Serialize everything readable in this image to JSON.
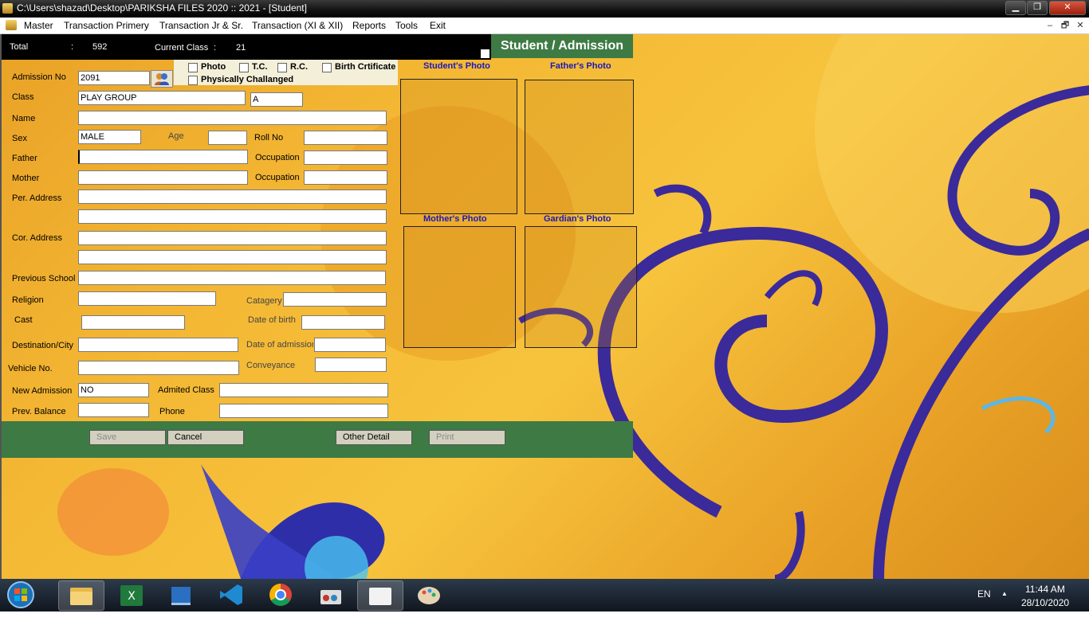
{
  "window": {
    "title": "C:\\Users\\shazad\\Desktop\\PARIKSHA FILES 2020 :: 2021 - [Student]",
    "buttons": {
      "minimize": "▁",
      "maximize": "❐",
      "close": "✕"
    }
  },
  "menubar": {
    "items": [
      "Master",
      "Transaction Primery",
      "Transaction Jr & Sr.",
      "Transaction (XI & XII)",
      "Reports",
      "Tools",
      "Exit"
    ],
    "mdi_buttons": {
      "minimize": "–",
      "restore": "🗗",
      "close": "✕"
    }
  },
  "status": {
    "total_label": "Total",
    "total_sep": ":",
    "total_value": "592",
    "class_label": "Current Class",
    "class_sep": ":",
    "class_value": "21"
  },
  "header": {
    "title": "Student / Admission"
  },
  "checkboxes": {
    "photo": "Photo",
    "tc": "T.C.",
    "rc": "R.C.",
    "birth": "Birth Crtificate",
    "physically": "Physically Challanged"
  },
  "form": {
    "admission_no": {
      "label": "Admission No",
      "value": "2091"
    },
    "class": {
      "label": "Class",
      "value": "PLAY GROUP",
      "section": "A"
    },
    "name": {
      "label": "Name",
      "value": ""
    },
    "sex": {
      "label": "Sex",
      "value": "MALE"
    },
    "age": {
      "label": "Age",
      "value": ""
    },
    "roll_no": {
      "label": "Roll No",
      "value": ""
    },
    "father": {
      "label": "Father",
      "value": ""
    },
    "father_occupation": {
      "label": "Occupation",
      "value": ""
    },
    "mother": {
      "label": "Mother",
      "value": ""
    },
    "mother_occupation": {
      "label": "Occupation",
      "value": ""
    },
    "per_address": {
      "label": "Per. Address",
      "line1": "",
      "line2": ""
    },
    "cor_address": {
      "label": "Cor. Address",
      "line1": "",
      "line2": ""
    },
    "previous_school": {
      "label": "Previous School",
      "value": ""
    },
    "religion": {
      "label": "Religion",
      "value": ""
    },
    "category": {
      "label": "Catagery",
      "value": ""
    },
    "cast": {
      "label": "Cast",
      "value": ""
    },
    "dob": {
      "label": "Date of birth",
      "value": ""
    },
    "destination": {
      "label": "Destination/City",
      "value": ""
    },
    "date_admission": {
      "label": "Date of admission",
      "value": ""
    },
    "vehicle": {
      "label": "Vehicle No.",
      "value": ""
    },
    "conveyance": {
      "label": "Conveyance",
      "value": ""
    },
    "new_admission": {
      "label": "New Admission",
      "value": "NO"
    },
    "admitted_class": {
      "label": "Admited Class",
      "value": ""
    },
    "prev_balance": {
      "label": "Prev. Balance",
      "value": ""
    },
    "phone": {
      "label": "Phone",
      "value": ""
    }
  },
  "photos": {
    "student": "Student's Photo",
    "father": "Father's Photo",
    "mother": "Mother's Photo",
    "guardian": "Gardian's Photo"
  },
  "buttons": {
    "save": "Save",
    "cancel": "Cancel",
    "other_detail": "Other Detail",
    "print": "Print"
  },
  "taskbar": {
    "language": "EN",
    "tray_arrow": "▲",
    "time": "11:44 AM",
    "date": "28/10/2020",
    "apps": [
      "windows-explorer",
      "excel",
      "notepad-app",
      "vscode",
      "chrome",
      "app-tools",
      "folder-app",
      "paint"
    ]
  },
  "colors": {
    "panel_green": "#3e7a44",
    "photo_label_blue": "#1a1ab8",
    "background_orange": "#f4b834",
    "swirl_purple": "#3b2a9a"
  }
}
